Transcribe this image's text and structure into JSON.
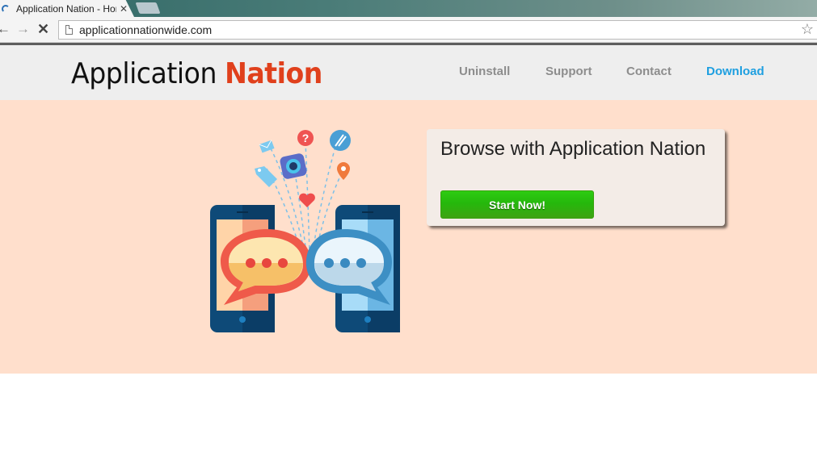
{
  "browser": {
    "tab_title": "Application Nation - Home",
    "url": "applicationnationwide.com"
  },
  "header": {
    "logo_primary": "Application",
    "logo_accent": "Nation",
    "nav": [
      {
        "label": "Uninstall"
      },
      {
        "label": "Support"
      },
      {
        "label": "Contact"
      },
      {
        "label": "Download"
      }
    ]
  },
  "hero": {
    "title": "Browse with Application Nation",
    "button_label": "Start Now!"
  },
  "colors": {
    "accent": "#e0401c",
    "download_link": "#1e9fe0",
    "hero_bg": "#ffdfcc",
    "button_green": "#2ecc12"
  }
}
